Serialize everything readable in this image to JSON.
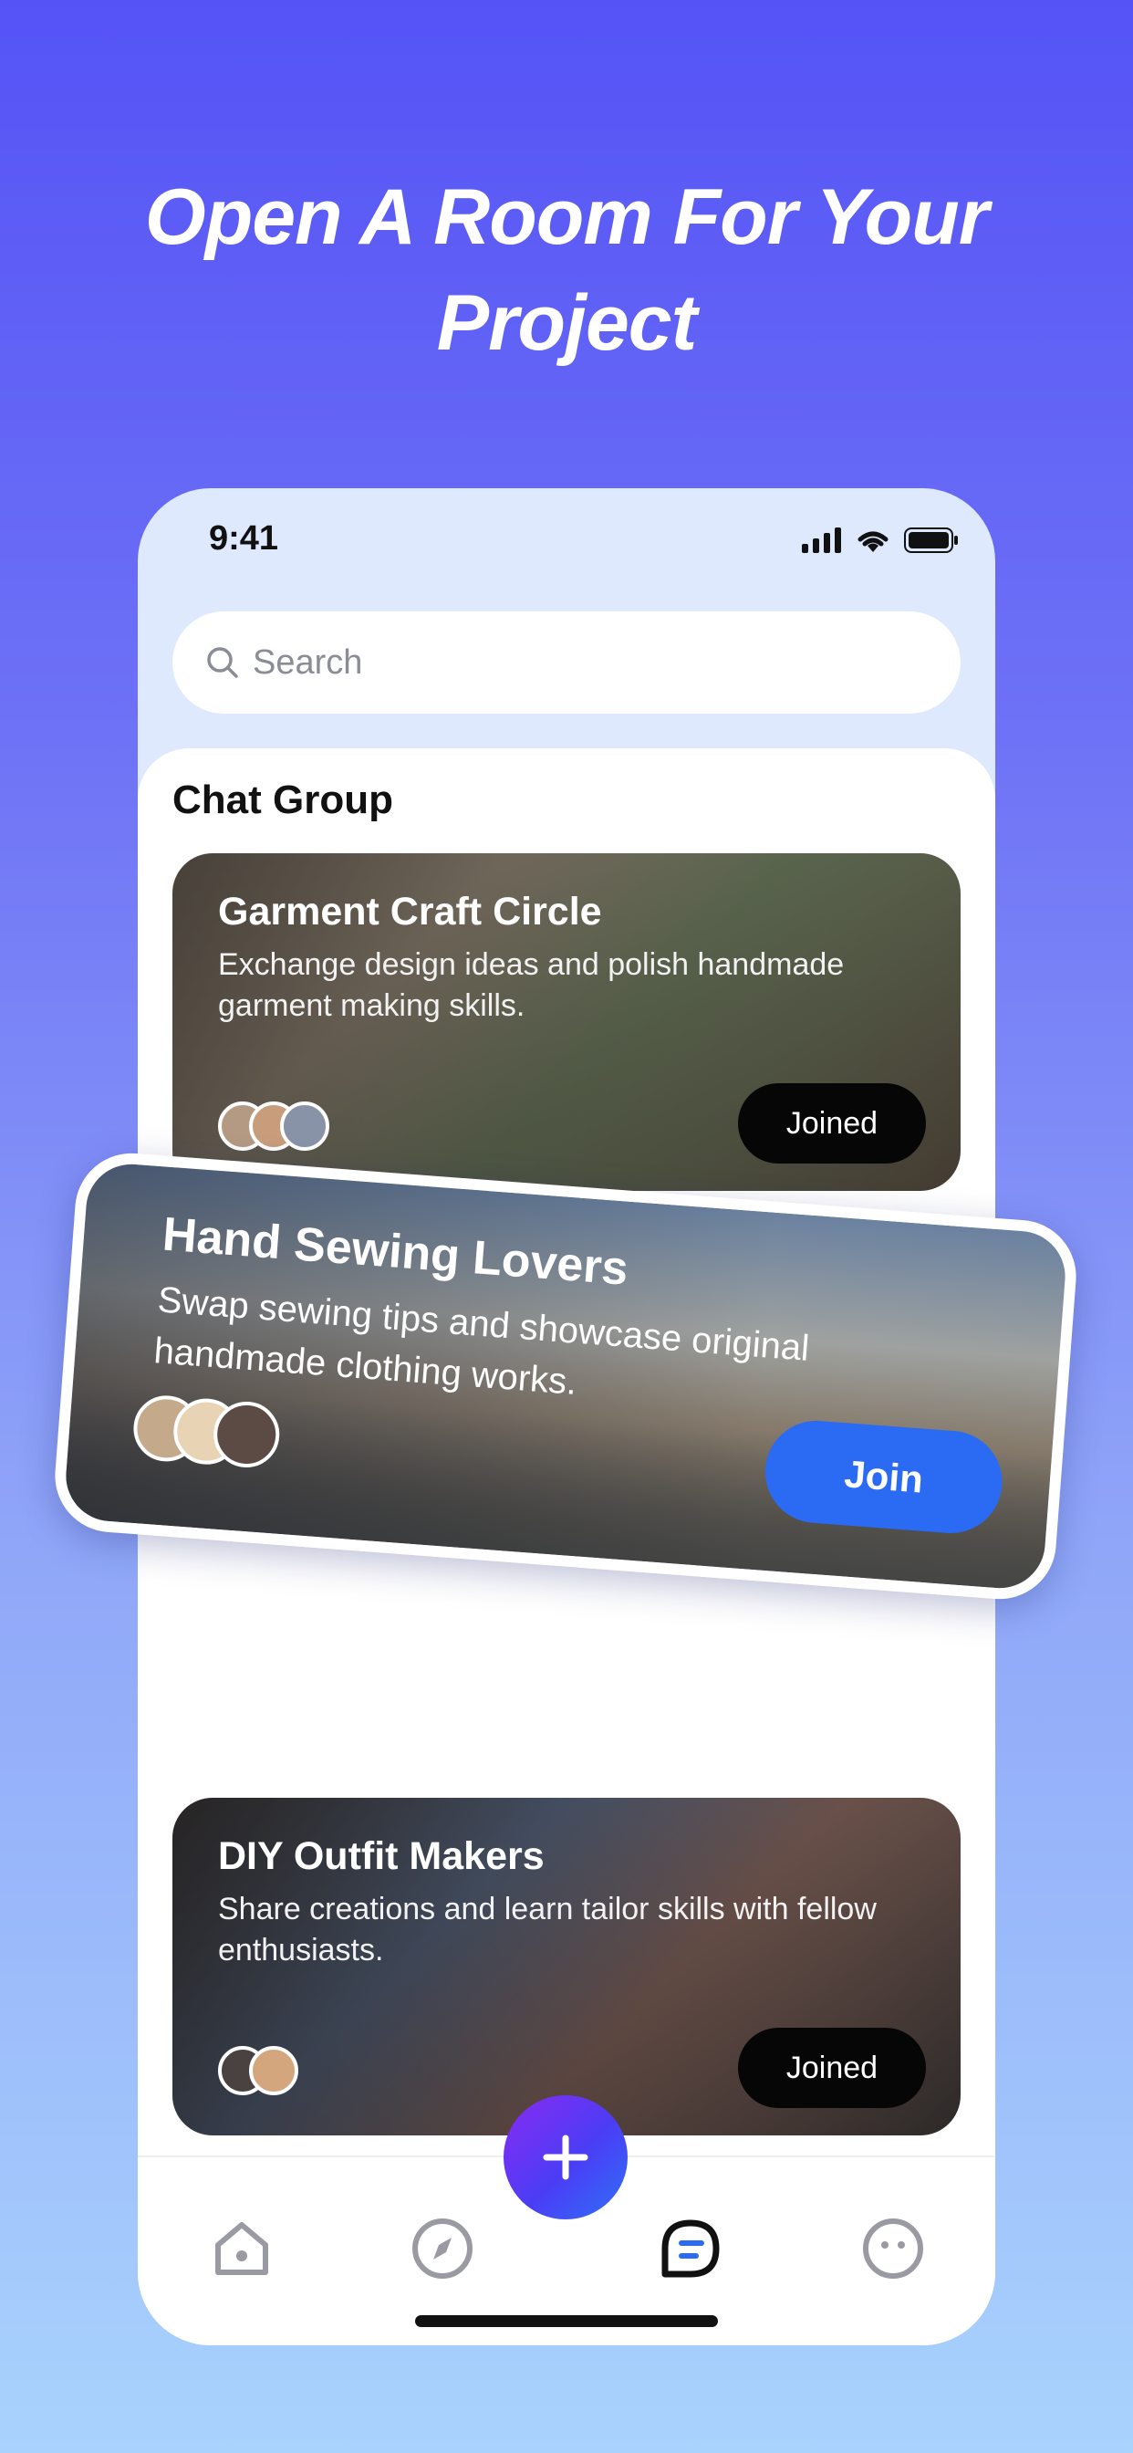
{
  "headline": {
    "line1": "Open A Room For Your",
    "line2": "Project"
  },
  "status_bar": {
    "time": "9:41"
  },
  "search": {
    "placeholder": "Search"
  },
  "section_title": "Chat Group",
  "groups": [
    {
      "title": "Garment Craft Circle",
      "description": "Exchange design ideas and polish handmade garment making skills.",
      "button": "Joined"
    },
    {
      "title": "Hand Sewing Lovers",
      "description": "Swap sewing tips and showcase original handmade clothing works.",
      "button": "Join"
    },
    {
      "title": "DIY Outfit Makers",
      "description": "Share creations and learn tailor skills with fellow enthusiasts.",
      "button": "Joined"
    }
  ],
  "nav": {
    "items": [
      "home-icon",
      "compass-icon",
      "chat-icon",
      "profile-icon"
    ],
    "fab": "plus-icon"
  },
  "colors": {
    "accent": "#2b6af3",
    "background_top": "#5553f6",
    "background_bottom": "#a9d3fd",
    "button_dark": "#060606"
  }
}
